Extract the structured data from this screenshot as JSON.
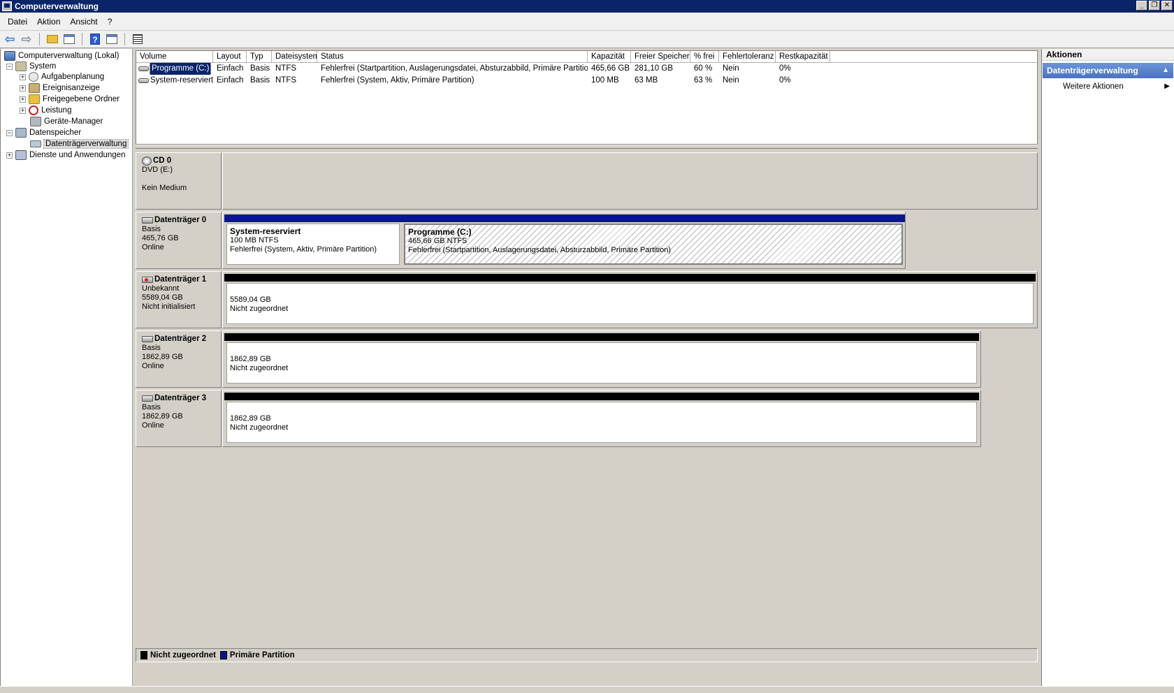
{
  "window": {
    "title": "Computerverwaltung"
  },
  "menu": [
    "Datei",
    "Aktion",
    "Ansicht",
    "?"
  ],
  "tree": {
    "root": "Computerverwaltung (Lokal)",
    "system": "System",
    "aufgaben": "Aufgabenplanung",
    "ereignis": "Ereignisanzeige",
    "freigabe": "Freigegebene Ordner",
    "leistung": "Leistung",
    "geraete": "Geräte-Manager",
    "datenspeicher": "Datenspeicher",
    "datentraeger": "Datenträgerverwaltung",
    "dienste": "Dienste und Anwendungen"
  },
  "volumes": {
    "headers": [
      "Volume",
      "Layout",
      "Typ",
      "Dateisystem",
      "Status",
      "Kapazität",
      "Freier Speicher",
      "% frei",
      "Fehlertoleranz",
      "Restkapazität"
    ],
    "rows": [
      [
        "Programme (C:)",
        "Einfach",
        "Basis",
        "NTFS",
        "Fehlerfrei (Startpartition, Auslagerungsdatei, Absturzabbild, Primäre Partition)",
        "465,66 GB",
        "281,10 GB",
        "60 %",
        "Nein",
        "0%"
      ],
      [
        "System-reserviert",
        "Einfach",
        "Basis",
        "NTFS",
        "Fehlerfrei (System, Aktiv, Primäre Partition)",
        "100 MB",
        "63 MB",
        "63 %",
        "Nein",
        "0%"
      ]
    ]
  },
  "disks": {
    "cd0": {
      "name": "CD 0",
      "l1": "DVD (E:)",
      "l2": "",
      "l3": "Kein Medium"
    },
    "d0": {
      "name": "Datenträger 0",
      "l1": "Basis",
      "l2": "465,76 GB",
      "l3": "Online",
      "p1": {
        "title": "System-reserviert",
        "size": "100 MB NTFS",
        "status": "Fehlerfrei (System, Aktiv, Primäre Partition)"
      },
      "p2": {
        "title": "Programme  (C:)",
        "size": "465,66 GB NTFS",
        "status": "Fehlerfrei (Startpartition, Auslagerungsdatei, Absturzabbild, Primäre Partition)"
      }
    },
    "d1": {
      "name": "Datenträger 1",
      "l1": "Unbekannt",
      "l2": "5589,04 GB",
      "l3": "Nicht initialisiert",
      "psize": "5589,04 GB",
      "pstatus": "Nicht zugeordnet"
    },
    "d2": {
      "name": "Datenträger 2",
      "l1": "Basis",
      "l2": "1862,89 GB",
      "l3": "Online",
      "psize": "1862,89 GB",
      "pstatus": "Nicht zugeordnet"
    },
    "d3": {
      "name": "Datenträger 3",
      "l1": "Basis",
      "l2": "1862,89 GB",
      "l3": "Online",
      "psize": "1862,89 GB",
      "pstatus": "Nicht zugeordnet"
    }
  },
  "legend": {
    "unalloc": "Nicht zugeordnet",
    "primary": "Primäre Partition"
  },
  "actions": {
    "header": "Aktionen",
    "section": "Datenträgerverwaltung",
    "more": "Weitere Aktionen"
  },
  "colors": {
    "primary_partition": "#0a168c",
    "unallocated": "#000000",
    "titlebar": "#0a246a"
  }
}
